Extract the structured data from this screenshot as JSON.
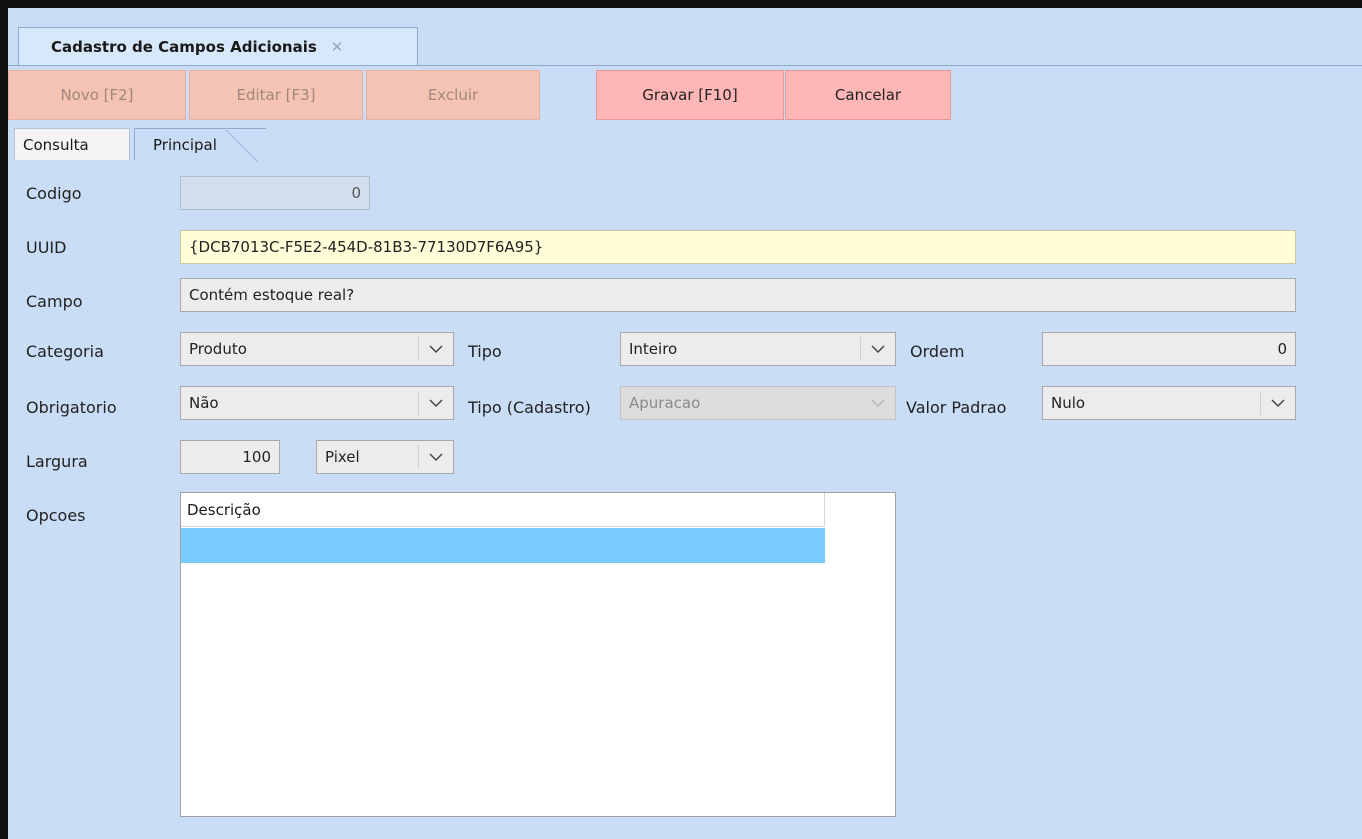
{
  "window": {
    "tab_title": "Cadastro de Campos Adicionais",
    "tab_close": "✕"
  },
  "toolbar": {
    "novo": "Novo [F2]",
    "editar": "Editar [F3]",
    "excluir": "Excluir",
    "gravar": "Gravar [F10]",
    "cancelar": "Cancelar"
  },
  "subtabs": {
    "consulta": "Consulta",
    "principal": "Principal"
  },
  "form": {
    "codigo_label": "Codigo",
    "codigo_value": "0",
    "uuid_label": "UUID",
    "uuid_value": "{DCB7013C-F5E2-454D-81B3-77130D7F6A95}",
    "campo_label": "Campo",
    "campo_value": "Contém estoque real?",
    "categoria_label": "Categoria",
    "categoria_value": "Produto",
    "tipo_label": "Tipo",
    "tipo_value": "Inteiro",
    "ordem_label": "Ordem",
    "ordem_value": "0",
    "obrigatorio_label": "Obrigatorio",
    "obrigatorio_value": "Não",
    "tipo_cadastro_label": "Tipo (Cadastro)",
    "tipo_cadastro_value": "Apuracao",
    "valor_padrao_label": "Valor Padrao",
    "valor_padrao_value": "Nulo",
    "largura_label": "Largura",
    "largura_value": "100",
    "largura_unit": "Pixel",
    "opcoes_label": "Opcoes",
    "opcoes_column": "Descrição"
  },
  "icons": {
    "dropdown": "chevron-down-icon",
    "close": "close-icon"
  },
  "colors": {
    "background": "#c9ddf6",
    "disabled_button": "#f5c3b3",
    "active_button": "#ffb6b6",
    "uuid_field": "#fffed9",
    "selected_row": "#78cbff"
  }
}
